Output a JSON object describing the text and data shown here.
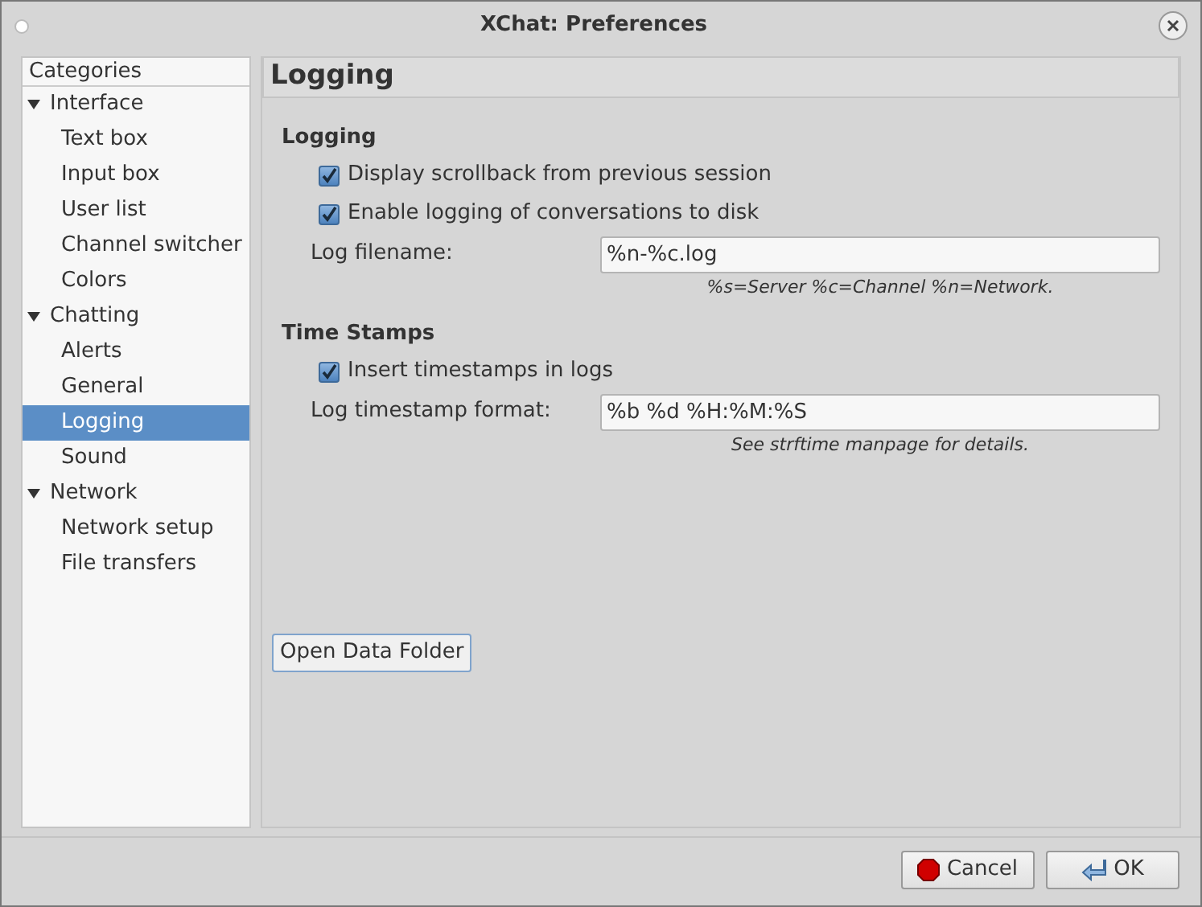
{
  "window": {
    "title": "XChat: Preferences"
  },
  "sidebar": {
    "header": "Categories",
    "items": [
      {
        "label": "Interface",
        "expanded": true,
        "selected": false,
        "children": [
          {
            "label": "Text box",
            "selected": false
          },
          {
            "label": "Input box",
            "selected": false
          },
          {
            "label": "User list",
            "selected": false
          },
          {
            "label": "Channel switcher",
            "selected": false
          },
          {
            "label": "Colors",
            "selected": false
          }
        ]
      },
      {
        "label": "Chatting",
        "expanded": true,
        "selected": false,
        "children": [
          {
            "label": "Alerts",
            "selected": false
          },
          {
            "label": "General",
            "selected": false
          },
          {
            "label": "Logging",
            "selected": true
          },
          {
            "label": "Sound",
            "selected": false
          }
        ]
      },
      {
        "label": "Network",
        "expanded": true,
        "selected": false,
        "children": [
          {
            "label": "Network setup",
            "selected": false
          },
          {
            "label": "File transfers",
            "selected": false
          }
        ]
      }
    ]
  },
  "page": {
    "title": "Logging",
    "sections": [
      {
        "heading": "Logging",
        "rows": [
          {
            "kind": "checkbox",
            "label": "Display scrollback from previous session",
            "checked": true
          },
          {
            "kind": "checkbox",
            "label": "Enable logging of conversations to disk",
            "checked": true
          },
          {
            "kind": "field",
            "label": "Log filename:",
            "value": "%n-%c.log",
            "hint": "%s=Server %c=Channel %n=Network."
          }
        ]
      },
      {
        "heading": "Time Stamps",
        "rows": [
          {
            "kind": "checkbox",
            "label": "Insert timestamps in logs",
            "checked": true
          },
          {
            "kind": "field",
            "label": "Log timestamp format:",
            "value": "%b %d %H:%M:%S",
            "hint": "See strftime manpage for details."
          }
        ]
      }
    ],
    "button": "Open Data Folder"
  },
  "buttons": [
    {
      "kind": "cancel",
      "label": "Cancel"
    },
    {
      "kind": "ok",
      "label": "OK"
    }
  ]
}
